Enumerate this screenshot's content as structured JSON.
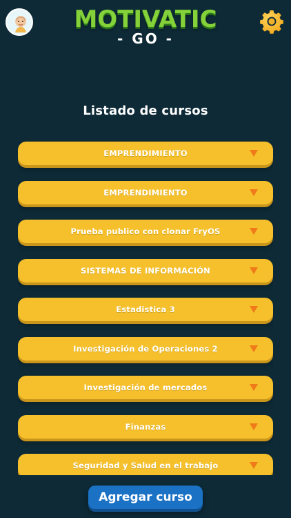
{
  "header": {
    "logo_text": "MOTIVATIC",
    "tagline": "- GO -"
  },
  "page": {
    "title": "Listado de cursos"
  },
  "courses": [
    {
      "label": "EMPRENDIMIENTO"
    },
    {
      "label": "EMPRENDIMIENTO"
    },
    {
      "label": "Prueba publico con clonar FryOS"
    },
    {
      "label": "SISTEMAS DE INFORMACIÓN"
    },
    {
      "label": "Estadistica 3"
    },
    {
      "label": "Investigación de Operaciones 2"
    },
    {
      "label": "Investigación de mercados"
    },
    {
      "label": "Finanzas"
    },
    {
      "label": "Seguridad y Salud en el trabajo"
    }
  ],
  "actions": {
    "add_course_label": "Agregar curso"
  },
  "colors": {
    "background": "#0d2a36",
    "course_item": "#f5c02b",
    "chevron": "#f07a1a",
    "add_button": "#1b72c4",
    "logo": "#84d13a"
  },
  "icons": {
    "avatar": "avatar-icon",
    "settings": "gear-icon",
    "dropdown": "chevron-down-icon"
  }
}
